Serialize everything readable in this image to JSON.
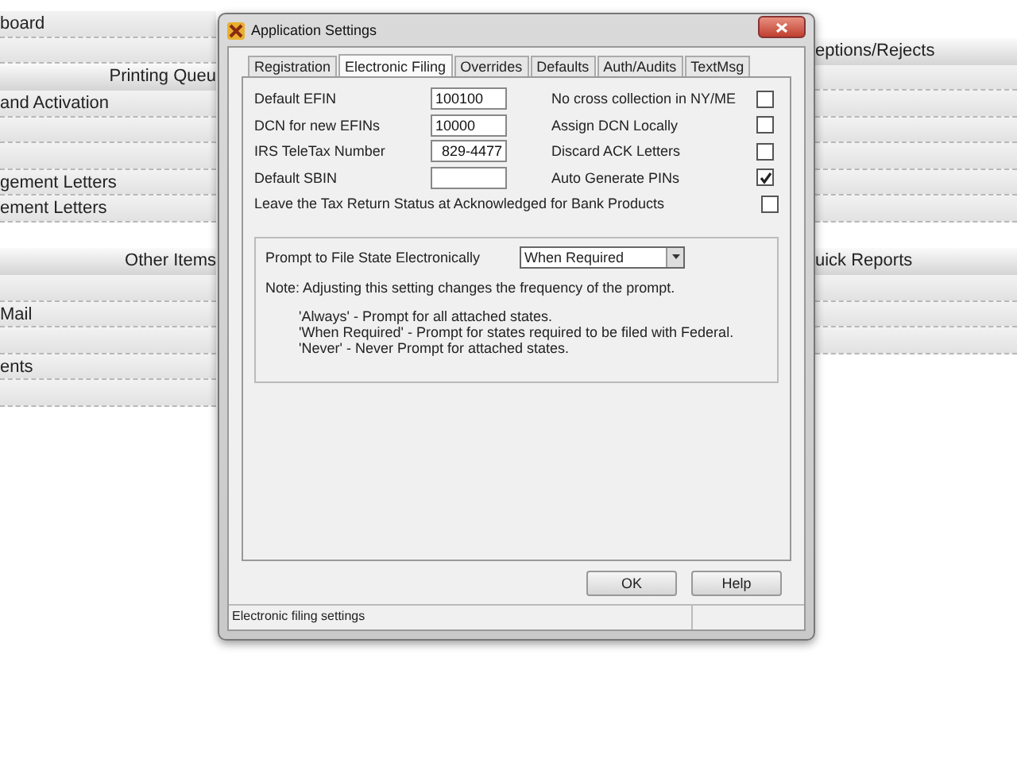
{
  "left_panel": [
    {
      "kind": "row",
      "text": "board"
    },
    {
      "kind": "row"
    },
    {
      "kind": "header",
      "text": "Printing Queu"
    },
    {
      "kind": "row",
      "text": "and Activation"
    },
    {
      "kind": "row"
    },
    {
      "kind": "row"
    },
    {
      "kind": "row",
      "text": "gement Letters"
    },
    {
      "kind": "row",
      "text": "ement Letters"
    },
    {
      "kind": "gap"
    },
    {
      "kind": "header",
      "text": "Other Items"
    },
    {
      "kind": "row"
    },
    {
      "kind": "row",
      "text": "Mail"
    },
    {
      "kind": "row"
    },
    {
      "kind": "row",
      "text": "ents"
    },
    {
      "kind": "row"
    }
  ],
  "right_panel": [
    {
      "kind": "gap"
    },
    {
      "kind": "header",
      "text": "eptions/Rejects"
    },
    {
      "kind": "row"
    },
    {
      "kind": "row"
    },
    {
      "kind": "row"
    },
    {
      "kind": "row"
    },
    {
      "kind": "row"
    },
    {
      "kind": "row"
    },
    {
      "kind": "gap"
    },
    {
      "kind": "header",
      "text": "uick Reports"
    },
    {
      "kind": "row"
    },
    {
      "kind": "row"
    },
    {
      "kind": "row"
    }
  ],
  "dialog": {
    "title": "Application Settings",
    "tabs": [
      {
        "label": "Registration",
        "selected": false
      },
      {
        "label": "Electronic Filing",
        "selected": true
      },
      {
        "label": "Overrides",
        "selected": false
      },
      {
        "label": "Defaults",
        "selected": false
      },
      {
        "label": "Auth/Audits",
        "selected": false
      },
      {
        "label": "TextMsg",
        "selected": false
      }
    ],
    "fields": [
      {
        "label": "Default EFIN",
        "value": "100100"
      },
      {
        "label": "DCN for new EFINs",
        "value": "10000"
      },
      {
        "label": "IRS TeleTax Number",
        "value": "829-4477"
      },
      {
        "label": "Default SBIN"
      }
    ],
    "checkboxes": [
      {
        "label": "No cross collection in NY/ME",
        "checked": false
      },
      {
        "label": "Assign DCN Locally",
        "checked": false
      },
      {
        "label": "Discard ACK Letters",
        "checked": false
      },
      {
        "label": "Auto Generate PINs",
        "checked": true
      }
    ],
    "bank_option": {
      "label": "Leave the Tax Return Status at Acknowledged for Bank Products",
      "checked": false
    },
    "group": {
      "prompt_label": "Prompt to File State Electronically",
      "dropdown": {
        "value": "When Required"
      },
      "note": "Note: Adjusting this setting changes the frequency of the prompt.",
      "options": [
        "'Always' - Prompt for all attached states.",
        "'When Required' - Prompt for states required to be filed with Federal.",
        "'Never' - Never Prompt for attached states."
      ]
    },
    "buttons": [
      "OK",
      "Help"
    ],
    "status_bar": "Electronic filing settings"
  }
}
